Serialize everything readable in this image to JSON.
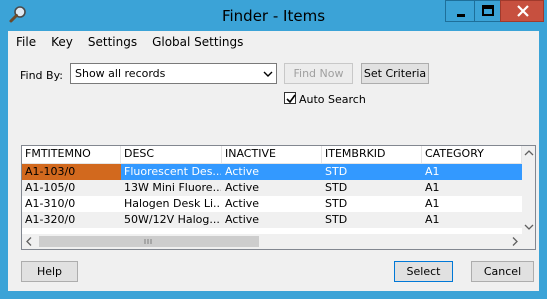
{
  "window": {
    "title": "Finder - Items",
    "icon": "magnifier-icon",
    "colors": {
      "frame": "#3ba3d7",
      "close": "#c7503f",
      "selection": "#3399ff",
      "key_cell": "#d2691e"
    }
  },
  "menu": {
    "items": [
      "File",
      "Key",
      "Settings",
      "Global Settings"
    ]
  },
  "find": {
    "label": "Find By:",
    "selected": "Show all records",
    "find_now": "Find Now",
    "set_criteria": "Set Criteria",
    "auto_search_label": "Auto Search",
    "auto_search_checked": true
  },
  "grid": {
    "columns": [
      "FMTITEMNO",
      "DESC",
      "INACTIVE",
      "ITEMBRKID",
      "CATEGORY"
    ],
    "rows": [
      [
        "A1-103/0",
        "Fluorescent Des...",
        "Active",
        "STD",
        "A1"
      ],
      [
        "A1-105/0",
        "13W Mini Fluore...",
        "Active",
        "STD",
        "A1"
      ],
      [
        "A1-310/0",
        "Halogen Desk Li...",
        "Active",
        "STD",
        "A1"
      ],
      [
        "A1-320/0",
        "50W/12V Halog...",
        "Active",
        "STD",
        "A1"
      ]
    ]
  },
  "footer": {
    "help": "Help",
    "select": "Select",
    "cancel": "Cancel"
  }
}
